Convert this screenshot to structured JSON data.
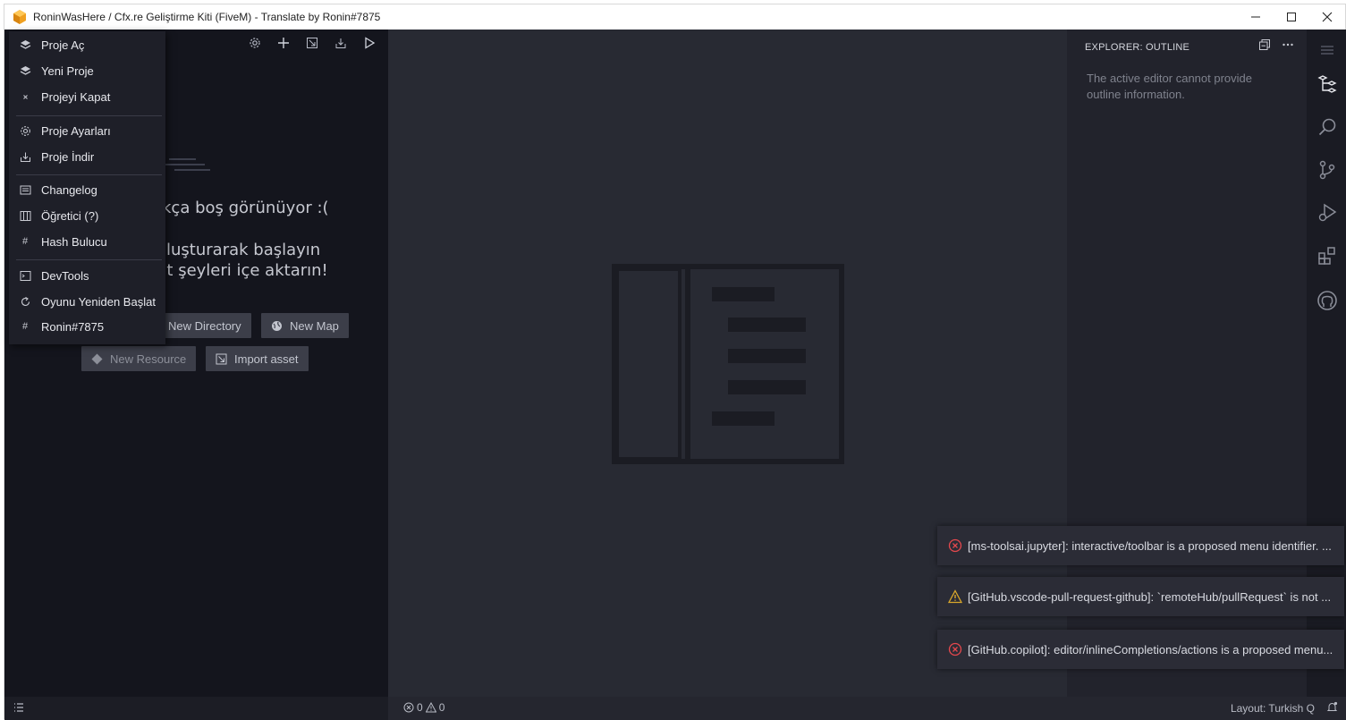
{
  "window": {
    "title": "RoninWasHere / Cfx.re Geliştirme Kiti (FiveM) - Translate by Ronin#7875",
    "minimize_glyph": "—",
    "maximize_glyph": "☐",
    "close_glyph": "✕"
  },
  "menu": {
    "items": [
      {
        "label": "Proje Aç",
        "icon": "layers-icon"
      },
      {
        "label": "Yeni Proje",
        "icon": "layers-icon"
      },
      {
        "label": "Projeyi Kapat",
        "icon": "close-icon"
      },
      {
        "label": "Proje Ayarları",
        "icon": "gear-icon"
      },
      {
        "label": "Proje İndir",
        "icon": "download-icon"
      },
      {
        "label": "Changelog",
        "icon": "changelog-icon"
      },
      {
        "label": "Öğretici (?)",
        "icon": "book-icon"
      },
      {
        "label": "Hash Bulucu",
        "icon": "hash-icon"
      },
      {
        "label": "DevTools",
        "icon": "terminal-icon"
      },
      {
        "label": "Oyunu Yeniden Başlat",
        "icon": "restart-icon"
      },
      {
        "label": "Ronin#7875",
        "icon": "hash-icon"
      }
    ]
  },
  "sidebar": {
    "empty_line1": "kça boş görünüyor :(",
    "empty_line2": "oluşturarak başlayın",
    "empty_line3": "ut şeyleri içe aktarın!",
    "buttons": {
      "new_directory": "New Directory",
      "new_map": "New Map",
      "new_resource": "New Resource",
      "import_asset": "Import asset"
    }
  },
  "outline": {
    "header": "EXPLORER: OUTLINE",
    "message": "The active editor cannot provide outline information."
  },
  "statusbar": {
    "errors": "0",
    "warnings": "0",
    "layout": "Layout: Turkish Q"
  },
  "notifications": [
    {
      "type": "error",
      "text": "[ms-toolsai.jupyter]: interactive/toolbar is a proposed menu identifier. ..."
    },
    {
      "type": "warning",
      "text": "[GitHub.vscode-pull-request-github]: `remoteHub/pullRequest` is not ..."
    },
    {
      "type": "error",
      "text": "[GitHub.copilot]: editor/inlineCompletions/actions is a proposed menu..."
    }
  ],
  "colors": {
    "error": "#e5484d",
    "warning": "#d9a72b",
    "app_icon": "#f0a020"
  }
}
